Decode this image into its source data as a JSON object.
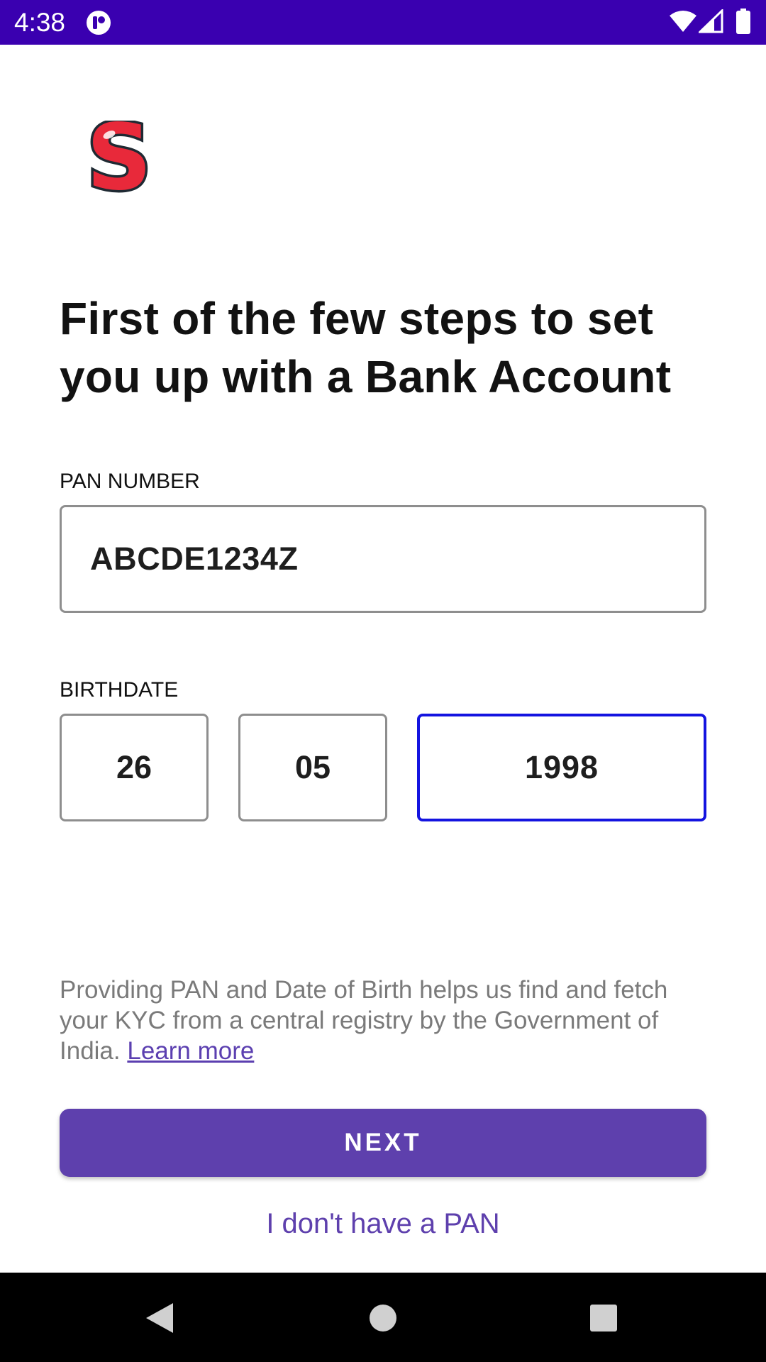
{
  "status_bar": {
    "time": "4:38",
    "background": "#3a00b0",
    "icons": [
      "app-notification-icon",
      "wifi-icon",
      "cell-signal-icon",
      "battery-icon"
    ]
  },
  "logo": {
    "letter": "S",
    "color": "#e8293a"
  },
  "heading": "First of the few steps to set you up with a Bank Account",
  "pan": {
    "label": "PAN NUMBER",
    "value": "ABCDE1234Z"
  },
  "birthdate": {
    "label": "BIRTHDATE",
    "day": "26",
    "month": "05",
    "year": "1998",
    "focused_field": "year",
    "focus_color": "#1414e0"
  },
  "info": {
    "text": "Providing PAN and Date of Birth helps us find and fetch your KYC from a central registry by the Government of India.",
    "link_label": "Learn more"
  },
  "actions": {
    "next_label": "NEXT",
    "no_pan_label": "I don't have a PAN",
    "accent": "#5e40ad"
  },
  "nav_bar": {
    "icons": [
      "back-icon",
      "home-icon",
      "recents-icon"
    ]
  }
}
